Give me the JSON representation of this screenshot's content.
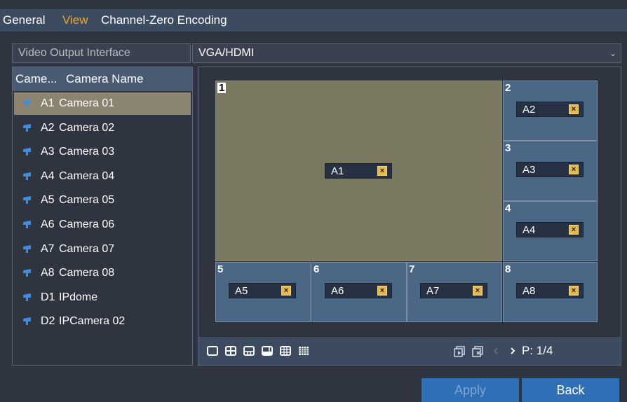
{
  "tabs": [
    "General",
    "View",
    "Channel-Zero Encoding"
  ],
  "active_tab": "View",
  "video_output": {
    "label": "Video Output Interface",
    "value": "VGA/HDMI"
  },
  "camera_list": {
    "headers": [
      "Came...",
      "Camera Name"
    ],
    "rows": [
      {
        "id": "A1",
        "name": "Camera 01"
      },
      {
        "id": "A2",
        "name": "Camera 02"
      },
      {
        "id": "A3",
        "name": "Camera 03"
      },
      {
        "id": "A4",
        "name": "Camera 04"
      },
      {
        "id": "A5",
        "name": "Camera 05"
      },
      {
        "id": "A6",
        "name": "Camera 06"
      },
      {
        "id": "A7",
        "name": "Camera 07"
      },
      {
        "id": "A8",
        "name": "Camera 08"
      },
      {
        "id": "D1",
        "name": "IPdome"
      },
      {
        "id": "D2",
        "name": "IPCamera 02"
      }
    ],
    "selected_id": "A1"
  },
  "windows": [
    {
      "num": "1",
      "camera": "A1"
    },
    {
      "num": "2",
      "camera": "A2"
    },
    {
      "num": "3",
      "camera": "A3"
    },
    {
      "num": "4",
      "camera": "A4"
    },
    {
      "num": "5",
      "camera": "A5"
    },
    {
      "num": "6",
      "camera": "A6"
    },
    {
      "num": "7",
      "camera": "A7"
    },
    {
      "num": "8",
      "camera": "A8"
    }
  ],
  "remove_glyph": "×",
  "layout_icons": [
    "layout-1-icon",
    "layout-4-icon",
    "layout-6-icon",
    "layout-8-icon",
    "layout-9-icon",
    "layout-16-icon"
  ],
  "nav_icons": [
    "start-sequence-icon",
    "stop-sequence-icon",
    "prev-page-icon",
    "next-page-icon"
  ],
  "page": "P: 1/4",
  "buttons": {
    "apply": "Apply",
    "back": "Back"
  },
  "colors": {
    "accent_tab": "#f3a51b",
    "selected_window": "#7b7860",
    "window": "#4a6885",
    "button": "#2f6fb5"
  }
}
